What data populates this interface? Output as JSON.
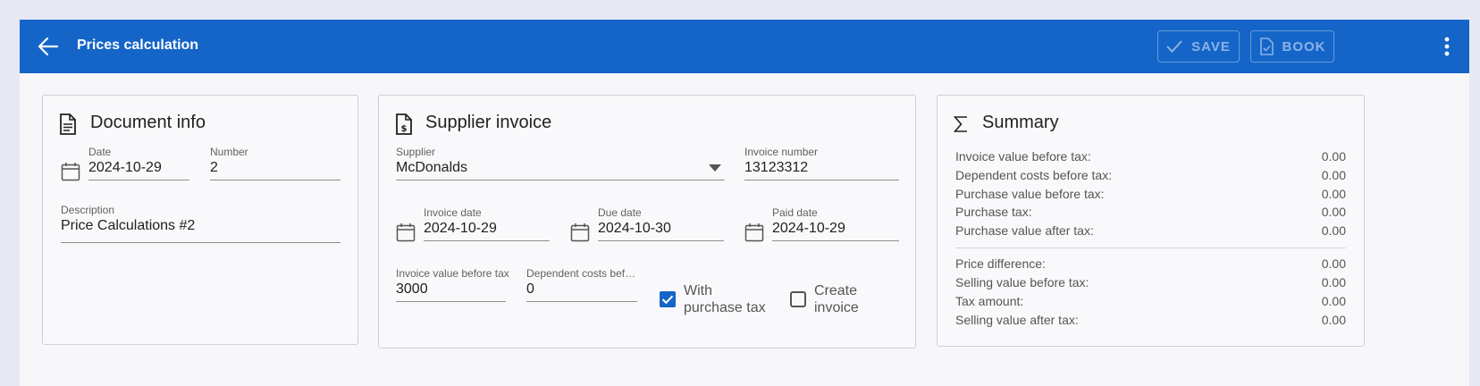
{
  "appbar": {
    "title": "Prices calculation",
    "save_label": "SAVE",
    "book_label": "BOOK"
  },
  "document_info": {
    "title": "Document info",
    "date_label": "Date",
    "date_value": "2024-10-29",
    "number_label": "Number",
    "number_value": "2",
    "description_label": "Description",
    "description_value": "Price Calculations #2"
  },
  "supplier_invoice": {
    "title": "Supplier invoice",
    "supplier_label": "Supplier",
    "supplier_value": "McDonalds",
    "invoice_number_label": "Invoice number",
    "invoice_number_value": "13123312",
    "invoice_date_label": "Invoice date",
    "invoice_date_value": "2024-10-29",
    "due_date_label": "Due date",
    "due_date_value": "2024-10-30",
    "paid_date_label": "Paid date",
    "paid_date_value": "2024-10-29",
    "invoice_value_label": "Invoice value before tax",
    "invoice_value_value": "3000",
    "dependent_costs_label": "Dependent costs befor...",
    "dependent_costs_value": "0",
    "with_purchase_tax_line1": "With",
    "with_purchase_tax_line2": "purchase tax",
    "with_purchase_tax_checked": true,
    "create_invoice_line1": "Create",
    "create_invoice_line2": "invoice",
    "create_invoice_checked": false
  },
  "summary": {
    "title": "Summary",
    "rows_top": [
      {
        "label": "Invoice value before tax:",
        "value": "0.00"
      },
      {
        "label": "Dependent costs before tax:",
        "value": "0.00"
      },
      {
        "label": "Purchase value before tax:",
        "value": "0.00"
      },
      {
        "label": "Purchase tax:",
        "value": "0.00"
      },
      {
        "label": "Purchase value after tax:",
        "value": "0.00"
      }
    ],
    "rows_bottom": [
      {
        "label": "Price difference:",
        "value": "0.00"
      },
      {
        "label": "Selling value before tax:",
        "value": "0.00"
      },
      {
        "label": "Tax amount:",
        "value": "0.00"
      },
      {
        "label": "Selling value after tax:",
        "value": "0.00"
      }
    ]
  },
  "icons": {
    "back": "arrow-left-icon",
    "save": "check-icon",
    "book": "document-check-icon",
    "menu": "more-vertical-icon",
    "document": "document-icon",
    "invoice": "invoice-dollar-icon",
    "summary": "sigma-icon",
    "calendar": "calendar-icon",
    "dropdown": "chevron-down-icon"
  },
  "colors": {
    "appbar": "#1565c8",
    "accent": "#1565c8"
  }
}
